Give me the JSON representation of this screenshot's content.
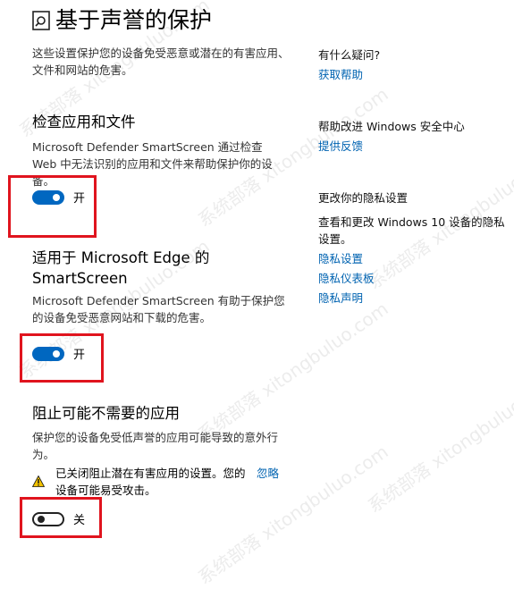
{
  "page": {
    "title": "基于声誉的保护",
    "intro": "这些设置保护您的设备免受恶意或潜在的有害应用、文件和网站的危害。"
  },
  "sections": {
    "apps_files": {
      "heading": "检查应用和文件",
      "description": "Microsoft Defender SmartScreen 通过检查 Web 中无法识别的应用和文件来帮助保护你的设备。",
      "toggle_state": "开"
    },
    "edge": {
      "heading_line1": "适用于 Microsoft Edge 的",
      "heading_line2": "SmartScreen",
      "description": "Microsoft Defender SmartScreen 有助于保护您的设备免受恶意网站和下载的危害。",
      "toggle_state": "开"
    },
    "pua": {
      "heading": "阻止可能不需要的应用",
      "description": "保护您的设备免受低声誉的应用可能导致的意外行为。",
      "warning_line1": "已关闭阻止潜在有害应用的设置。您的",
      "warning_line2": "设备可能易受攻击。",
      "dismiss_label": "忽略",
      "toggle_state": "关"
    }
  },
  "sidebar": {
    "questions_heading": "有什么疑问?",
    "get_help": "获取帮助",
    "improve_heading": "帮助改进 Windows 安全中心",
    "feedback": "提供反馈",
    "privacy_heading": "更改你的隐私设置",
    "privacy_desc": "查看和更改 Windows 10 设备的隐私设置。",
    "privacy_settings": "隐私设置",
    "privacy_dashboard": "隐私仪表板",
    "privacy_statement": "隐私声明"
  },
  "watermark": "系统部落 xitongbuluo.com",
  "colors": {
    "accent": "#0067c0",
    "link": "#0063b1",
    "highlight_box": "#e0141e",
    "warning": "#f2c200"
  },
  "icons": {
    "title_icon": "reputation-shield-icon",
    "warning_icon": "warning-triangle-icon"
  }
}
